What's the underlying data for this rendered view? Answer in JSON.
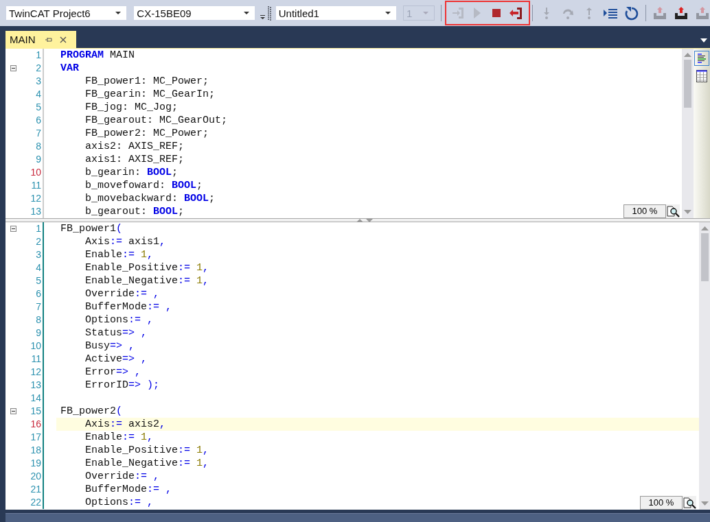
{
  "toolbar": {
    "dropdowns": [
      {
        "value": "TwinCAT Project6",
        "kind": "selector",
        "disabled": false
      },
      {
        "value": "CX-15BE09",
        "kind": "selector",
        "disabled": false
      },
      {
        "value": "Untitled1",
        "kind": "selector",
        "disabled": false
      },
      {
        "value": "1",
        "kind": "counter",
        "disabled": true
      }
    ],
    "debug_buttons": [
      {
        "kind": "login",
        "disabled": true
      },
      {
        "kind": "start",
        "disabled": true
      },
      {
        "kind": "stop",
        "disabled": false
      },
      {
        "kind": "logout",
        "disabled": false
      }
    ],
    "step_buttons": [
      {
        "kind": "step-into",
        "disabled": true
      },
      {
        "kind": "step-over",
        "disabled": true
      },
      {
        "kind": "step-out",
        "disabled": true
      },
      {
        "kind": "next-statement",
        "disabled": false
      },
      {
        "kind": "reset",
        "disabled": false
      }
    ],
    "download_buttons": [
      {
        "kind": "download",
        "disabled": true
      },
      {
        "kind": "download",
        "disabled": false
      },
      {
        "kind": "download",
        "disabled": true
      }
    ]
  },
  "tab": {
    "label": "MAIN",
    "selected": true
  },
  "declaration_pane": {
    "zoom": "100 %",
    "lines": [
      {
        "number": "1",
        "marked": false,
        "current": false,
        "foldable": false,
        "tokens": [
          {
            "kind": "keyword",
            "text": "PROGRAM"
          },
          {
            "kind": "plain",
            "text": " MAIN"
          }
        ]
      },
      {
        "number": "2",
        "marked": false,
        "current": false,
        "foldable": true,
        "tokens": [
          {
            "kind": "keyword",
            "text": "VAR"
          }
        ]
      },
      {
        "number": "3",
        "marked": false,
        "current": false,
        "foldable": false,
        "tokens": [
          {
            "kind": "plain",
            "text": "    FB_power1: MC_Power;"
          }
        ]
      },
      {
        "number": "4",
        "marked": false,
        "current": false,
        "foldable": false,
        "tokens": [
          {
            "kind": "plain",
            "text": "    FB_gearin: MC_GearIn;"
          }
        ]
      },
      {
        "number": "5",
        "marked": false,
        "current": false,
        "foldable": false,
        "tokens": [
          {
            "kind": "plain",
            "text": "    FB_jog: MC_Jog;"
          }
        ]
      },
      {
        "number": "6",
        "marked": false,
        "current": false,
        "foldable": false,
        "tokens": [
          {
            "kind": "plain",
            "text": "    FB_gearout: MC_GearOut;"
          }
        ]
      },
      {
        "number": "7",
        "marked": false,
        "current": false,
        "foldable": false,
        "tokens": [
          {
            "kind": "plain",
            "text": "    FB_power2: MC_Power;"
          }
        ]
      },
      {
        "number": "8",
        "marked": false,
        "current": false,
        "foldable": false,
        "tokens": [
          {
            "kind": "plain",
            "text": "    axis2: AXIS_REF;"
          }
        ]
      },
      {
        "number": "9",
        "marked": false,
        "current": false,
        "foldable": false,
        "tokens": [
          {
            "kind": "plain",
            "text": "    axis1: AXIS_REF;"
          }
        ]
      },
      {
        "number": "10",
        "marked": true,
        "current": false,
        "foldable": false,
        "tokens": [
          {
            "kind": "plain",
            "text": "    b_gearin: "
          },
          {
            "kind": "keyword",
            "text": "BOOL"
          },
          {
            "kind": "plain",
            "text": ";"
          }
        ]
      },
      {
        "number": "11",
        "marked": false,
        "current": false,
        "foldable": false,
        "tokens": [
          {
            "kind": "plain",
            "text": "    b_movefoward: "
          },
          {
            "kind": "keyword",
            "text": "BOOL"
          },
          {
            "kind": "plain",
            "text": ";"
          }
        ]
      },
      {
        "number": "12",
        "marked": false,
        "current": false,
        "foldable": false,
        "tokens": [
          {
            "kind": "plain",
            "text": "    b_movebackward: "
          },
          {
            "kind": "keyword",
            "text": "BOOL"
          },
          {
            "kind": "plain",
            "text": ";"
          }
        ]
      },
      {
        "number": "13",
        "marked": false,
        "current": false,
        "foldable": false,
        "tokens": [
          {
            "kind": "plain",
            "text": "    b_gearout: "
          },
          {
            "kind": "keyword",
            "text": "BOOL"
          },
          {
            "kind": "plain",
            "text": ";"
          }
        ]
      }
    ]
  },
  "implementation_pane": {
    "zoom": "100 %",
    "lines": [
      {
        "number": "1",
        "marked": false,
        "current": false,
        "foldable": true,
        "tokens": [
          {
            "kind": "plain",
            "text": "FB_power1"
          },
          {
            "kind": "operator",
            "text": "("
          }
        ]
      },
      {
        "number": "2",
        "marked": false,
        "current": false,
        "foldable": false,
        "tokens": [
          {
            "kind": "plain",
            "text": "    Axis"
          },
          {
            "kind": "operator",
            "text": ":="
          },
          {
            "kind": "plain",
            "text": " axis1"
          },
          {
            "kind": "operator",
            "text": ","
          }
        ]
      },
      {
        "number": "3",
        "marked": false,
        "current": false,
        "foldable": false,
        "tokens": [
          {
            "kind": "plain",
            "text": "    Enable"
          },
          {
            "kind": "operator",
            "text": ":="
          },
          {
            "kind": "number",
            "text": " 1"
          },
          {
            "kind": "operator",
            "text": ","
          }
        ]
      },
      {
        "number": "4",
        "marked": false,
        "current": false,
        "foldable": false,
        "tokens": [
          {
            "kind": "plain",
            "text": "    Enable_Positive"
          },
          {
            "kind": "operator",
            "text": ":="
          },
          {
            "kind": "number",
            "text": " 1"
          },
          {
            "kind": "operator",
            "text": ","
          }
        ]
      },
      {
        "number": "5",
        "marked": false,
        "current": false,
        "foldable": false,
        "tokens": [
          {
            "kind": "plain",
            "text": "    Enable_Negative"
          },
          {
            "kind": "operator",
            "text": ":="
          },
          {
            "kind": "number",
            "text": " 1"
          },
          {
            "kind": "operator",
            "text": ","
          }
        ]
      },
      {
        "number": "6",
        "marked": false,
        "current": false,
        "foldable": false,
        "tokens": [
          {
            "kind": "plain",
            "text": "    Override"
          },
          {
            "kind": "operator",
            "text": ":= ,"
          }
        ]
      },
      {
        "number": "7",
        "marked": false,
        "current": false,
        "foldable": false,
        "tokens": [
          {
            "kind": "plain",
            "text": "    BufferMode"
          },
          {
            "kind": "operator",
            "text": ":= ,"
          }
        ]
      },
      {
        "number": "8",
        "marked": false,
        "current": false,
        "foldable": false,
        "tokens": [
          {
            "kind": "plain",
            "text": "    Options"
          },
          {
            "kind": "operator",
            "text": ":= ,"
          }
        ]
      },
      {
        "number": "9",
        "marked": false,
        "current": false,
        "foldable": false,
        "tokens": [
          {
            "kind": "plain",
            "text": "    Status"
          },
          {
            "kind": "operator",
            "text": "=> ,"
          }
        ]
      },
      {
        "number": "10",
        "marked": false,
        "current": false,
        "foldable": false,
        "tokens": [
          {
            "kind": "plain",
            "text": "    Busy"
          },
          {
            "kind": "operator",
            "text": "=> ,"
          }
        ]
      },
      {
        "number": "11",
        "marked": false,
        "current": false,
        "foldable": false,
        "tokens": [
          {
            "kind": "plain",
            "text": "    Active"
          },
          {
            "kind": "operator",
            "text": "=> ,"
          }
        ]
      },
      {
        "number": "12",
        "marked": false,
        "current": false,
        "foldable": false,
        "tokens": [
          {
            "kind": "plain",
            "text": "    Error"
          },
          {
            "kind": "operator",
            "text": "=> ,"
          }
        ]
      },
      {
        "number": "13",
        "marked": false,
        "current": false,
        "foldable": false,
        "tokens": [
          {
            "kind": "plain",
            "text": "    ErrorID"
          },
          {
            "kind": "operator",
            "text": "=> );"
          }
        ]
      },
      {
        "number": "14",
        "marked": false,
        "current": false,
        "foldable": false
      },
      {
        "number": "15",
        "marked": false,
        "current": false,
        "foldable": true,
        "tokens": [
          {
            "kind": "plain",
            "text": "FB_power2"
          },
          {
            "kind": "operator",
            "text": "("
          }
        ]
      },
      {
        "number": "16",
        "marked": true,
        "current": true,
        "foldable": false,
        "tokens": [
          {
            "kind": "plain",
            "text": "    Axis"
          },
          {
            "kind": "operator",
            "text": ":="
          },
          {
            "kind": "plain",
            "text": " axis2"
          },
          {
            "kind": "operator",
            "text": ","
          }
        ]
      },
      {
        "number": "17",
        "marked": false,
        "current": false,
        "foldable": false,
        "tokens": [
          {
            "kind": "plain",
            "text": "    Enable"
          },
          {
            "kind": "operator",
            "text": ":="
          },
          {
            "kind": "number",
            "text": " 1"
          },
          {
            "kind": "operator",
            "text": ","
          }
        ]
      },
      {
        "number": "18",
        "marked": false,
        "current": false,
        "foldable": false,
        "tokens": [
          {
            "kind": "plain",
            "text": "    Enable_Positive"
          },
          {
            "kind": "operator",
            "text": ":="
          },
          {
            "kind": "number",
            "text": " 1"
          },
          {
            "kind": "operator",
            "text": ","
          }
        ]
      },
      {
        "number": "19",
        "marked": false,
        "current": false,
        "foldable": false,
        "tokens": [
          {
            "kind": "plain",
            "text": "    Enable_Negative"
          },
          {
            "kind": "operator",
            "text": ":="
          },
          {
            "kind": "number",
            "text": " 1"
          },
          {
            "kind": "operator",
            "text": ","
          }
        ]
      },
      {
        "number": "20",
        "marked": false,
        "current": false,
        "foldable": false,
        "tokens": [
          {
            "kind": "plain",
            "text": "    Override"
          },
          {
            "kind": "operator",
            "text": ":= ,"
          }
        ]
      },
      {
        "number": "21",
        "marked": false,
        "current": false,
        "foldable": false,
        "tokens": [
          {
            "kind": "plain",
            "text": "    BufferMode"
          },
          {
            "kind": "operator",
            "text": ":= ,"
          }
        ]
      },
      {
        "number": "22",
        "marked": false,
        "current": false,
        "foldable": false,
        "tokens": [
          {
            "kind": "plain",
            "text": "    Options"
          },
          {
            "kind": "operator",
            "text": ":= ,"
          }
        ]
      }
    ]
  }
}
